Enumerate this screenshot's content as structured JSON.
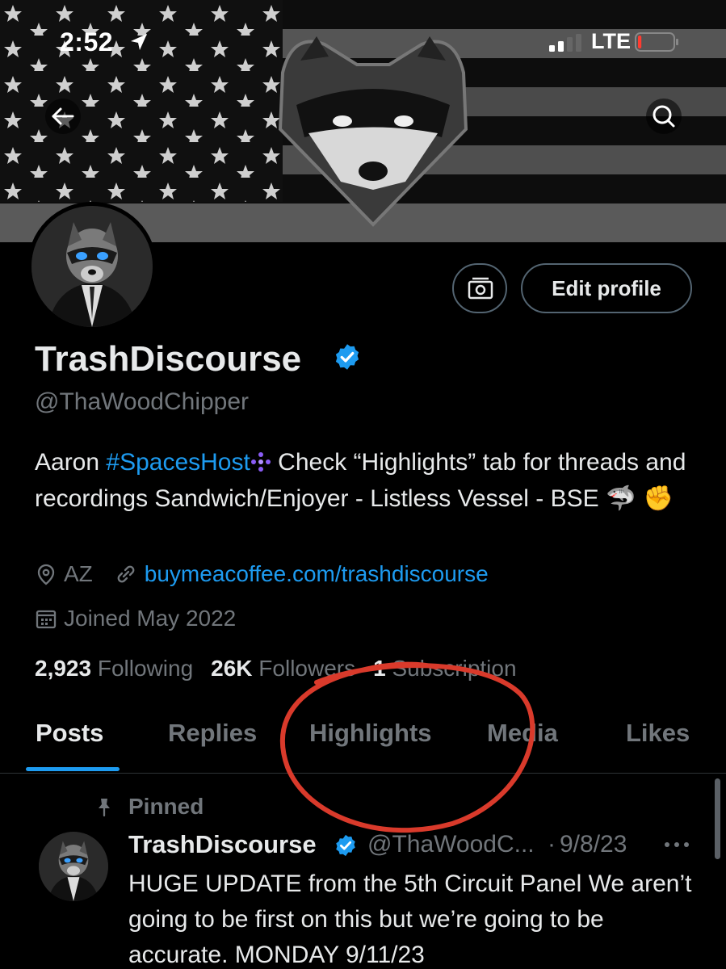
{
  "status_bar": {
    "time": "2:52",
    "network": "LTE",
    "battery_level": 0.1
  },
  "nav": {
    "back_icon": "arrow-left-icon",
    "search_icon": "search-icon"
  },
  "profile": {
    "display_name": "TrashDiscourse",
    "handle": "@ThaWoodChipper",
    "bio": {
      "part1": "Aaron ",
      "hashtag": "#SpacesHost",
      "part2": " Check “Highlights” tab for threads and recordings Sandwich/Enjoyer - Listless Vessel - BSE ",
      "emoji": "🦈 ✊"
    },
    "location": "AZ",
    "website": "buymeacoffee.com/trashdiscourse",
    "joined": "Joined May 2022",
    "following_count": "2,923",
    "following_label": "Following",
    "followers_count": "26K",
    "followers_label": "Followers",
    "subscription_count": "1",
    "subscription_label": "Subscription",
    "edit_profile_label": "Edit profile"
  },
  "tabs": [
    {
      "label": "Posts",
      "active": true
    },
    {
      "label": "Replies"
    },
    {
      "label": "Highlights"
    },
    {
      "label": "Media"
    },
    {
      "label": "Likes"
    }
  ],
  "tweet": {
    "pinned_label": "Pinned",
    "author": "TrashDiscourse",
    "handle": "@ThaWoodC...",
    "separator": "·",
    "date": "9/8/23",
    "text": "HUGE UPDATE from the 5th Circuit Panel  We aren’t going to be first on this but we’re going to be accurate. MONDAY 9/11/23"
  },
  "colors": {
    "accent": "#1d9bf0",
    "muted": "#71767b",
    "annotation": "#d93a2b"
  }
}
